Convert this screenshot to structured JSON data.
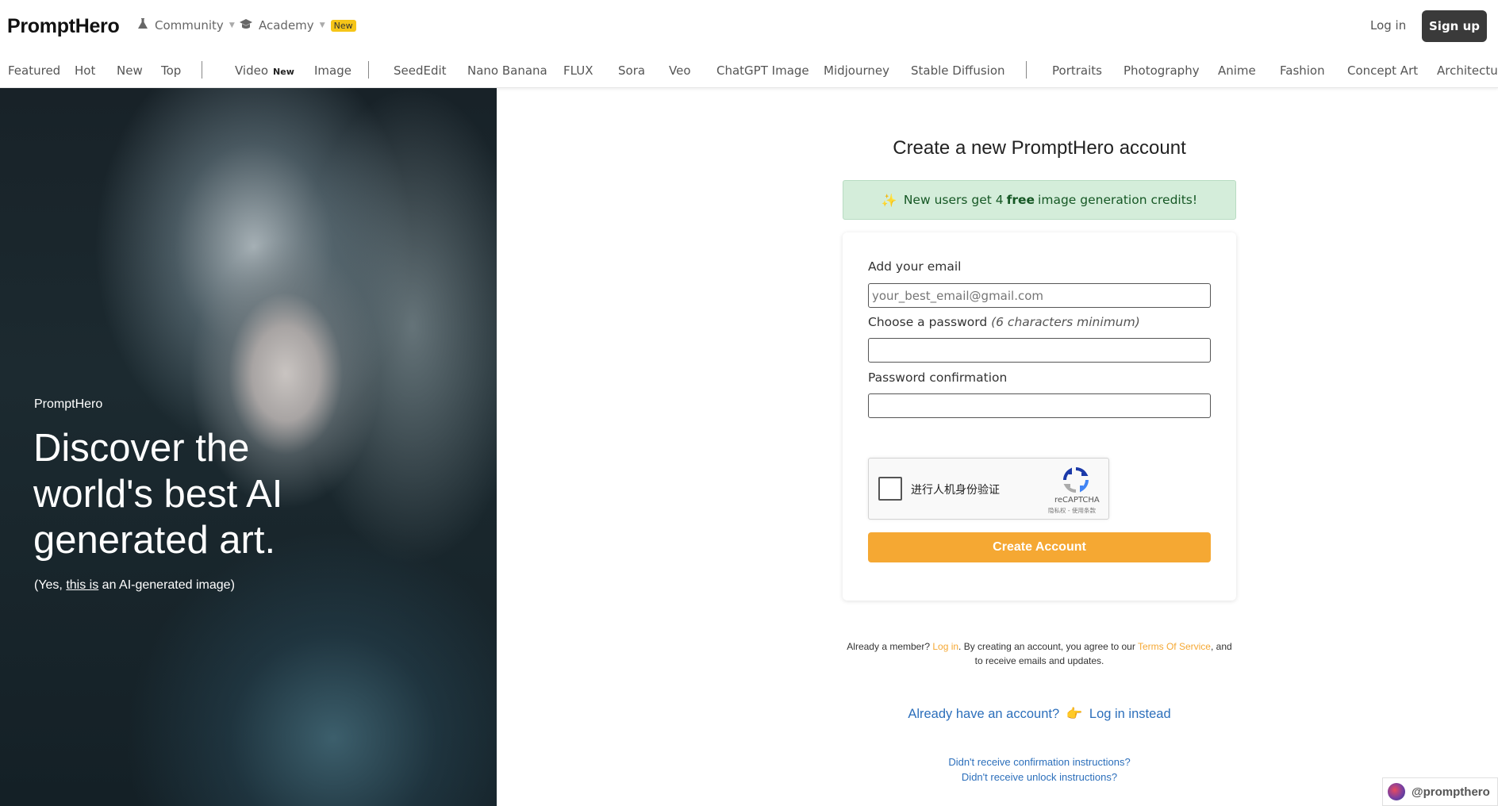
{
  "header": {
    "brand": "PromptHero",
    "community_label": "Community",
    "academy_label": "Academy",
    "academy_badge": "New",
    "login_label": "Log in",
    "signup_label": "Sign up"
  },
  "categories": {
    "featured": "Featured",
    "hot": "Hot",
    "new": "New",
    "top": "Top",
    "video": "Video",
    "video_badge": "New",
    "image": "Image",
    "seededit": "SeedEdit",
    "nano_banana": "Nano Banana",
    "flux": "FLUX",
    "sora": "Sora",
    "veo": "Veo",
    "chatgpt_image": "ChatGPT Image",
    "midjourney": "Midjourney",
    "stable_diffusion": "Stable Diffusion",
    "portraits": "Portraits",
    "photography": "Photography",
    "anime": "Anime",
    "fashion": "Fashion",
    "concept_art": "Concept Art",
    "architecture": "Architectu"
  },
  "hero": {
    "brand": "PromptHero",
    "title": "Discover the world's best AI generated art.",
    "sub_prefix": "(Yes, ",
    "sub_link": "this is",
    "sub_suffix": " an AI-generated image)"
  },
  "form": {
    "title": "Create a new PromptHero account",
    "promo_prefix": "New users get 4 ",
    "promo_bold": "free",
    "promo_suffix": " image generation credits!",
    "email_label": "Add your email",
    "email_placeholder": "your_best_email@gmail.com",
    "password_label": "Choose a password ",
    "password_hint": "(6 characters minimum)",
    "confirm_label": "Password confirmation",
    "captcha_text": "进行人机身份验证",
    "captcha_brand": "reCAPTCHA",
    "captcha_links": "隐私权 - 使用条款",
    "submit_label": "Create Account"
  },
  "footer": {
    "terms_1": "Already a member? ",
    "terms_login": "Log in",
    "terms_2": ". By creating an account, you agree to our ",
    "terms_tos": "Terms Of Service",
    "terms_3": ", and to receive emails and updates.",
    "have_account": "Already have an account?",
    "login_instead": "Log in instead",
    "confirm_instructions": "Didn't receive confirmation instructions?",
    "unlock_instructions": "Didn't receive unlock instructions?"
  },
  "social": {
    "handle": "@prompthero"
  },
  "icons": {
    "community": "flask-icon",
    "academy": "graduation-cap-icon",
    "promo": "sparkles-icon",
    "hand": "pointing-hand-icon"
  },
  "colors": {
    "accent": "#f5a833",
    "link": "#2c6fbb",
    "promo_bg": "#d4edda",
    "signup_bg": "#3a3a3a"
  }
}
